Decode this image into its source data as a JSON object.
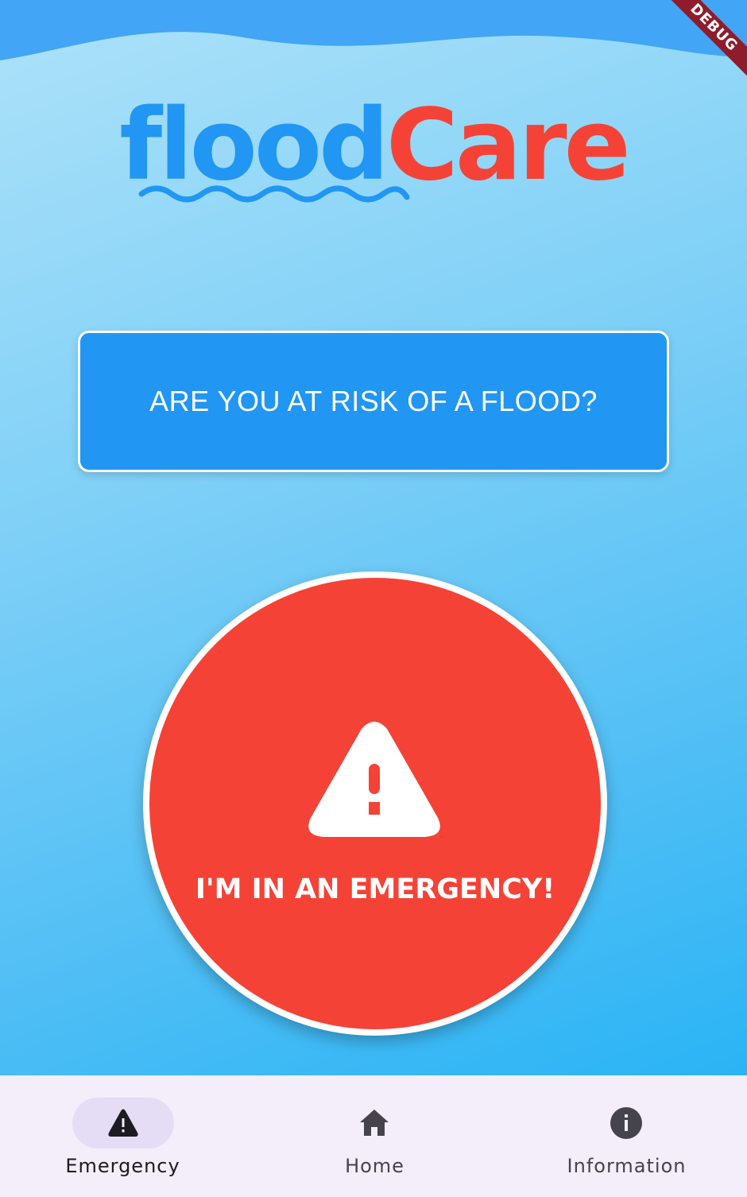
{
  "logo": {
    "part1": "flood",
    "part2": "Care"
  },
  "question_button": {
    "label": "ARE YOU AT RISK OF A FLOOD?"
  },
  "emergency_button": {
    "label": "I'M IN AN EMERGENCY!",
    "icon": "warning-icon"
  },
  "debug_banner": "DEBUG",
  "nav": {
    "items": [
      {
        "label": "Emergency",
        "icon": "warning-icon",
        "active": true
      },
      {
        "label": "Home",
        "icon": "home-icon",
        "active": false
      },
      {
        "label": "Information",
        "icon": "info-icon",
        "active": false
      }
    ]
  },
  "colors": {
    "primary_blue": "#2196f3",
    "emergency_red": "#f44336",
    "nav_background": "#f3eef9",
    "nav_indicator": "#e5ddf6"
  }
}
